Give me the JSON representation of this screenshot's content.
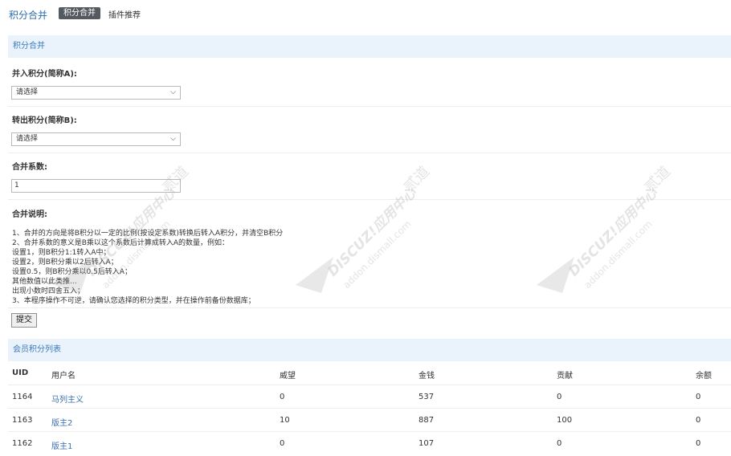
{
  "nav": {
    "title": "积分合并",
    "active_tab": "积分合并",
    "tab_plugins": "插件推荐"
  },
  "merge": {
    "section_title": "积分合并",
    "label_a_prefix": "并入积分(简称",
    "label_a_letter": "A",
    "label_a_suffix": "):",
    "select_a_value": "请选择",
    "label_b_prefix": "转出积分(简称",
    "label_b_letter": "B",
    "label_b_suffix": "):",
    "select_b_value": "请选择",
    "label_coef": "合并系数:",
    "coef_value": "1",
    "label_desc": "合并说明:",
    "desc_lines": [
      "1、合并的方向是将B积分以一定的比例(按设定系数)转换后转入A积分，并清空B积分",
      "2、合并系数的意义是B乘以这个系数后计算成转入A的数量，例如：",
      "设置1，则B积分1:1转入A中；",
      "设置2，则B积分乘以2后转入A；",
      "设置0.5，则B积分乘以0.5后转入A；",
      "其他数值以此类推...",
      "出现小数时四舍五入；",
      "3、本程序操作不可逆，请确认您选择的积分类型，并在操作前备份数据库；"
    ],
    "submit_label": "提交"
  },
  "members": {
    "section_title": "会员积分列表",
    "columns": [
      "UID",
      "用户名",
      "威望",
      "金钱",
      "贡献",
      "余额"
    ],
    "rows": [
      [
        "1164",
        "马列主义",
        "0",
        "537",
        "0",
        "0"
      ],
      [
        "1163",
        "版主2",
        "10",
        "887",
        "100",
        "0"
      ],
      [
        "1162",
        "版主1",
        "0",
        "107",
        "0",
        "0"
      ]
    ]
  },
  "watermark": {
    "text_main": "DISCUZ!应用中心",
    "text_sub": "addon.dismall.com",
    "text_brand": "贰道"
  },
  "colors": {
    "link": "#3a6fb0",
    "header_bg": "#eaf2fb",
    "active_tab_bg": "#555a60"
  }
}
